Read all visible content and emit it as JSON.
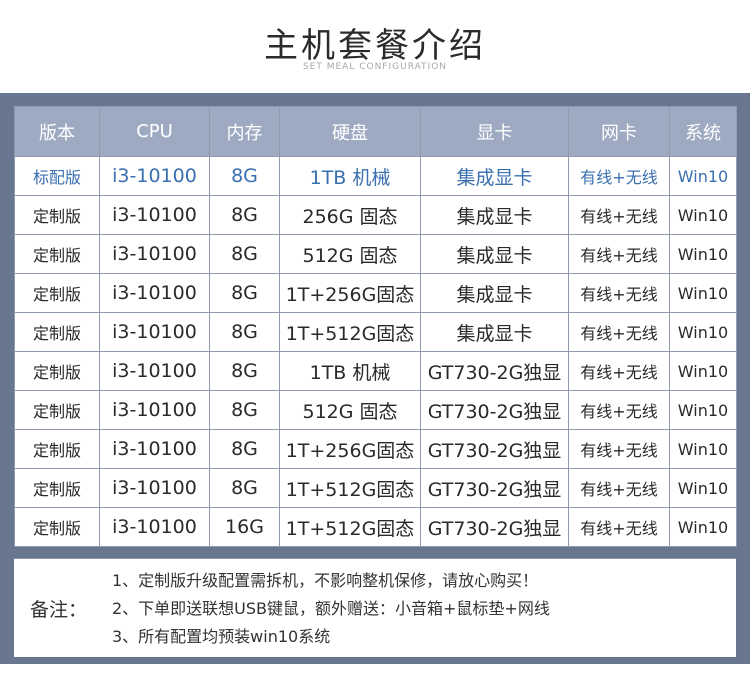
{
  "header": {
    "title": "主机套餐介绍",
    "subtitle": "SET MEAL CONFIGURATION"
  },
  "table": {
    "columns": [
      "版本",
      "CPU",
      "内存",
      "硬盘",
      "显卡",
      "网卡",
      "系统"
    ],
    "rows": [
      [
        "标配版",
        "i3-10100",
        "8G",
        "1TB 机械",
        "集成显卡",
        "有线+无线",
        "Win10"
      ],
      [
        "定制版",
        "i3-10100",
        "8G",
        "256G 固态",
        "集成显卡",
        "有线+无线",
        "Win10"
      ],
      [
        "定制版",
        "i3-10100",
        "8G",
        "512G 固态",
        "集成显卡",
        "有线+无线",
        "Win10"
      ],
      [
        "定制版",
        "i3-10100",
        "8G",
        "1T+256G固态",
        "集成显卡",
        "有线+无线",
        "Win10"
      ],
      [
        "定制版",
        "i3-10100",
        "8G",
        "1T+512G固态",
        "集成显卡",
        "有线+无线",
        "Win10"
      ],
      [
        "定制版",
        "i3-10100",
        "8G",
        "1TB 机械",
        "GT730-2G独显",
        "有线+无线",
        "Win10"
      ],
      [
        "定制版",
        "i3-10100",
        "8G",
        "512G 固态",
        "GT730-2G独显",
        "有线+无线",
        "Win10"
      ],
      [
        "定制版",
        "i3-10100",
        "8G",
        "1T+256G固态",
        "GT730-2G独显",
        "有线+无线",
        "Win10"
      ],
      [
        "定制版",
        "i3-10100",
        "8G",
        "1T+512G固态",
        "GT730-2G独显",
        "有线+无线",
        "Win10"
      ],
      [
        "定制版",
        "i3-10100",
        "16G",
        "1T+512G固态",
        "GT730-2G独显",
        "有线+无线",
        "Win10"
      ]
    ]
  },
  "notes": {
    "label": "备注：",
    "lines": [
      "1、定制版升级配置需拆机，不影响整机保修，请放心购买！",
      "2、下单即送联想USB键鼠，额外赠送：小音箱+鼠标垫+网线",
      "3、所有配置均预装win10系统"
    ]
  },
  "colors": {
    "frame": "#697690",
    "header_bg": "#9eaac2",
    "highlight_text": "#3a6fb0"
  }
}
